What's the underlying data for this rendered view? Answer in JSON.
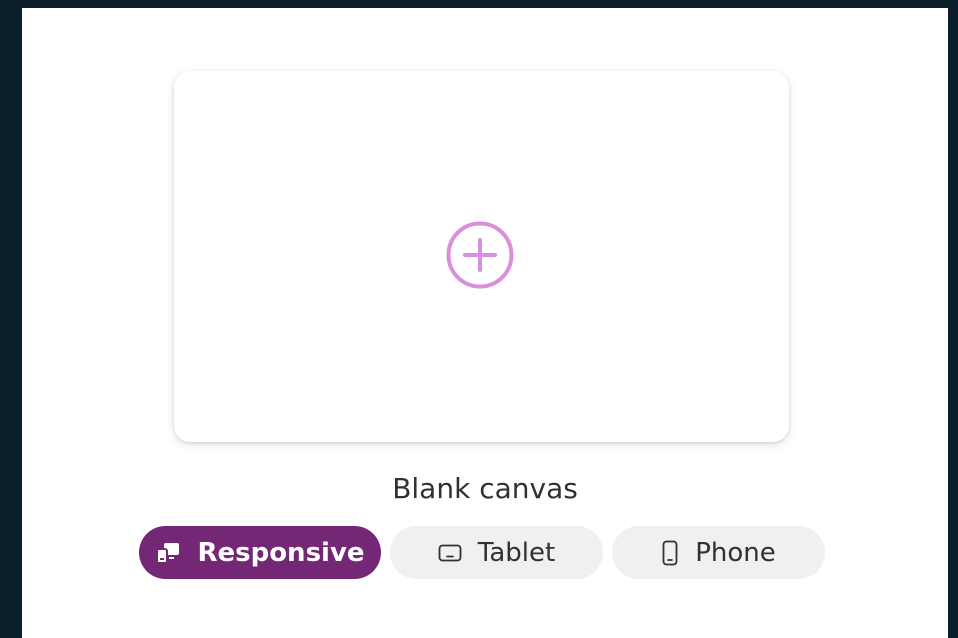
{
  "canvas": {
    "caption": "Blank canvas",
    "add_icon": "plus-circle-icon",
    "accent_color": "#d98fd9"
  },
  "layouts": [
    {
      "label": "Responsive",
      "icon": "responsive-devices-icon",
      "selected": true
    },
    {
      "label": "Tablet",
      "icon": "tablet-icon",
      "selected": false
    },
    {
      "label": "Phone",
      "icon": "phone-icon",
      "selected": false
    }
  ],
  "colors": {
    "selected_background": "#742774",
    "unselected_background": "#f0f0f0",
    "page_background": "#0b1f2b"
  }
}
